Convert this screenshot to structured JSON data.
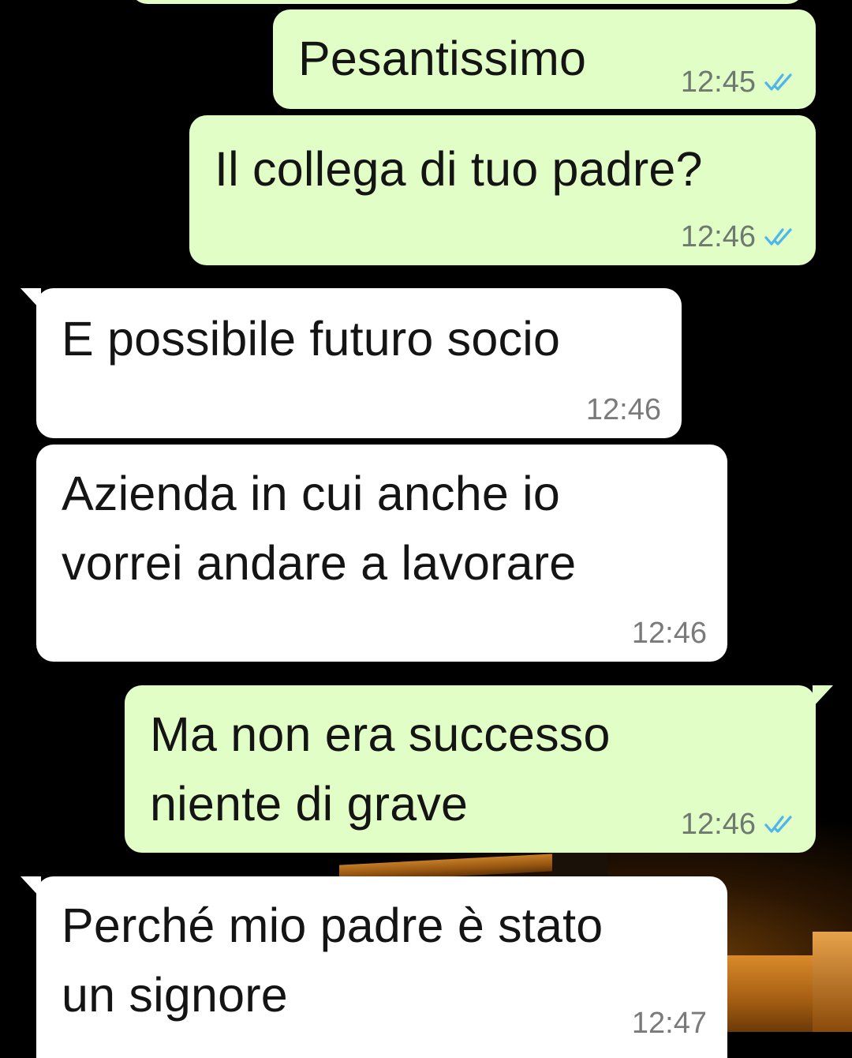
{
  "chat": {
    "messages": [
      {
        "text": "Pesantissimo",
        "time": "12:45",
        "direction": "outgoing",
        "status": "read-double-check-icon"
      },
      {
        "text": "Il collega di tuo padre?",
        "time": "12:46",
        "direction": "outgoing",
        "status": "read-double-check-icon"
      },
      {
        "text": "E possibile futuro socio",
        "time": "12:46",
        "direction": "incoming"
      },
      {
        "text": "Azienda in cui anche io\nvorrei andare a lavorare",
        "time": "12:46",
        "direction": "incoming"
      },
      {
        "text": "Ma non era successo\nniente di grave",
        "time": "12:46",
        "direction": "outgoing",
        "status": "read-double-check-icon"
      },
      {
        "text": "Perché mio padre è stato\nun signore",
        "time": "12:47",
        "direction": "incoming"
      }
    ]
  },
  "colors": {
    "outgoing_bubble": "#e1fec6",
    "incoming_bubble": "#ffffff",
    "read_ticks": "#4fb6ec",
    "background": "#000000"
  }
}
